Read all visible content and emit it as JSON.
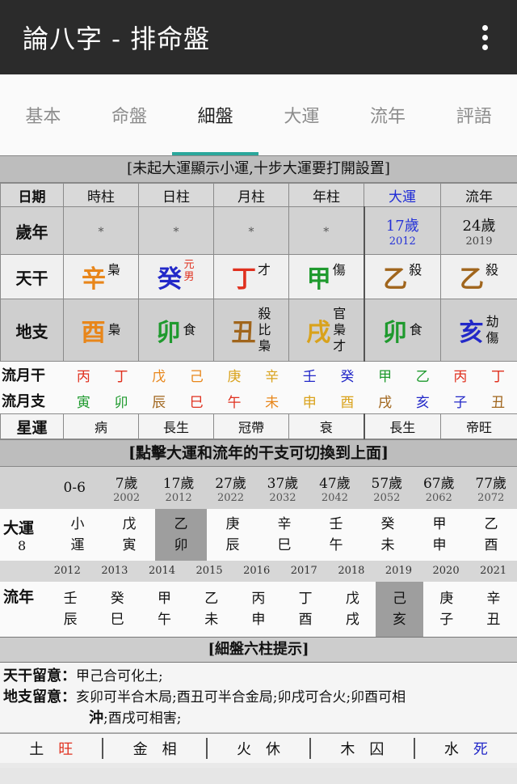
{
  "app": {
    "title": "論八字 - 排命盤"
  },
  "tabs": [
    "基本",
    "命盤",
    "細盤",
    "大運",
    "流年",
    "評語"
  ],
  "banner_top": "[未起大運顯示小運,十步大運要打開設置]",
  "pillar_table": {
    "headers": [
      "日期",
      "時柱",
      "日柱",
      "月柱",
      "年柱",
      "大運",
      "流年"
    ],
    "age_label": "歲年",
    "ages": [
      {
        "v": "*"
      },
      {
        "v": "*"
      },
      {
        "v": "*"
      },
      {
        "v": "*"
      },
      {
        "v": "17歲",
        "y": "2012"
      },
      {
        "v": "24歲",
        "y": "2019"
      }
    ],
    "stem_label": "天干",
    "stems": [
      {
        "c": "辛",
        "g": "梟",
        "color": "#e8861a"
      },
      {
        "c": "癸",
        "g": "元男",
        "color": "#2228c8"
      },
      {
        "c": "丁",
        "g": "才",
        "color": "#e0301e"
      },
      {
        "c": "甲",
        "g": "傷",
        "color": "#1f9a2e"
      },
      {
        "c": "乙",
        "g": "殺",
        "color": "#a0651c"
      },
      {
        "c": "乙",
        "g": "殺",
        "color": "#a0651c"
      }
    ],
    "branch_label": "地支",
    "branches": [
      {
        "c": "酉",
        "h": [
          "梟"
        ],
        "color": "#e8861a"
      },
      {
        "c": "卯",
        "h": [
          "食"
        ],
        "color": "#1f9a2e"
      },
      {
        "c": "丑",
        "h": [
          "殺",
          "比",
          "梟"
        ],
        "color": "#a0651c"
      },
      {
        "c": "戌",
        "h": [
          "官",
          "梟",
          "才"
        ],
        "color": "#d9a21b"
      },
      {
        "c": "卯",
        "h": [
          "食"
        ],
        "color": "#1f9a2e"
      },
      {
        "c": "亥",
        "h": [
          "劫",
          "傷"
        ],
        "color": "#2228c8"
      }
    ]
  },
  "liuyue": {
    "stem_label": "流月干",
    "stems": [
      {
        "c": "丙",
        "color": "#e0301e"
      },
      {
        "c": "丁",
        "color": "#e0301e"
      },
      {
        "c": "戊",
        "color": "#e8861a"
      },
      {
        "c": "己",
        "color": "#e8861a"
      },
      {
        "c": "庚",
        "color": "#d9a21b"
      },
      {
        "c": "辛",
        "color": "#d9a21b"
      },
      {
        "c": "壬",
        "color": "#2228c8"
      },
      {
        "c": "癸",
        "color": "#2228c8"
      },
      {
        "c": "甲",
        "color": "#1f9a2e"
      },
      {
        "c": "乙",
        "color": "#1f9a2e"
      },
      {
        "c": "丙",
        "color": "#e0301e"
      },
      {
        "c": "丁",
        "color": "#e0301e"
      }
    ],
    "branch_label": "流月支",
    "branches": [
      {
        "c": "寅",
        "color": "#1f9a2e"
      },
      {
        "c": "卯",
        "color": "#1f9a2e"
      },
      {
        "c": "辰",
        "color": "#a0651c"
      },
      {
        "c": "巳",
        "color": "#e0301e"
      },
      {
        "c": "午",
        "color": "#e0301e"
      },
      {
        "c": "未",
        "color": "#e8861a"
      },
      {
        "c": "申",
        "color": "#d9a21b"
      },
      {
        "c": "酉",
        "color": "#d9a21b"
      },
      {
        "c": "戌",
        "color": "#a0651c"
      },
      {
        "c": "亥",
        "color": "#2228c8"
      },
      {
        "c": "子",
        "color": "#2228c8"
      },
      {
        "c": "丑",
        "color": "#a0651c"
      }
    ]
  },
  "xingyun": {
    "label": "星運",
    "values": [
      "病",
      "長生",
      "冠帶",
      "衰",
      "長生",
      "帝旺"
    ]
  },
  "banner_mid": "[點擊大運和流年的干支可切換到上面]",
  "dayun": {
    "label": "大運",
    "num": "8",
    "heads": [
      {
        "age": "0-6",
        "yr": ""
      },
      {
        "age": "7歲",
        "yr": "2002"
      },
      {
        "age": "17歲",
        "yr": "2012"
      },
      {
        "age": "27歲",
        "yr": "2022"
      },
      {
        "age": "37歲",
        "yr": "2032"
      },
      {
        "age": "47歲",
        "yr": "2042"
      },
      {
        "age": "57歲",
        "yr": "2052"
      },
      {
        "age": "67歲",
        "yr": "2062"
      },
      {
        "age": "77歲",
        "yr": "2072"
      }
    ],
    "items": [
      {
        "t": "小",
        "b": "運"
      },
      {
        "t": "戊",
        "b": "寅"
      },
      {
        "t": "乙",
        "b": "卯"
      },
      {
        "t": "庚",
        "b": "辰"
      },
      {
        "t": "辛",
        "b": "巳"
      },
      {
        "t": "壬",
        "b": "午"
      },
      {
        "t": "癸",
        "b": "未"
      },
      {
        "t": "甲",
        "b": "申"
      },
      {
        "t": "乙",
        "b": "酉"
      }
    ]
  },
  "liunian": {
    "label": "流年",
    "years": [
      "2012",
      "2013",
      "2014",
      "2015",
      "2016",
      "2017",
      "2018",
      "2019",
      "2020",
      "2021"
    ],
    "items": [
      {
        "t": "壬",
        "b": "辰"
      },
      {
        "t": "癸",
        "b": "巳"
      },
      {
        "t": "甲",
        "b": "午"
      },
      {
        "t": "乙",
        "b": "未"
      },
      {
        "t": "丙",
        "b": "申"
      },
      {
        "t": "丁",
        "b": "酉"
      },
      {
        "t": "戊",
        "b": "戌"
      },
      {
        "t": "己",
        "b": "亥"
      },
      {
        "t": "庚",
        "b": "子"
      },
      {
        "t": "辛",
        "b": "丑"
      }
    ]
  },
  "banner_bottom": "[細盤六柱提示]",
  "hints": {
    "stem_label": "天干留意：",
    "stem_text": "甲己合可化土;",
    "branch_label": "地支留意：",
    "branch_text": "亥卯可半合木局;酉丑可半合金局;卯戌可合火;卯酉可相",
    "branch_text2_bold": "沖",
    "branch_text2": ";酉戌可相害;"
  },
  "wuxing": [
    {
      "e": "土",
      "s": "旺",
      "color": "#e0301e"
    },
    {
      "e": "金",
      "s": "相",
      "color": "#111111"
    },
    {
      "e": "火",
      "s": "休",
      "color": "#111111"
    },
    {
      "e": "木",
      "s": "囚",
      "color": "#111111"
    },
    {
      "e": "水",
      "s": "死",
      "color": "#2228c8"
    }
  ]
}
